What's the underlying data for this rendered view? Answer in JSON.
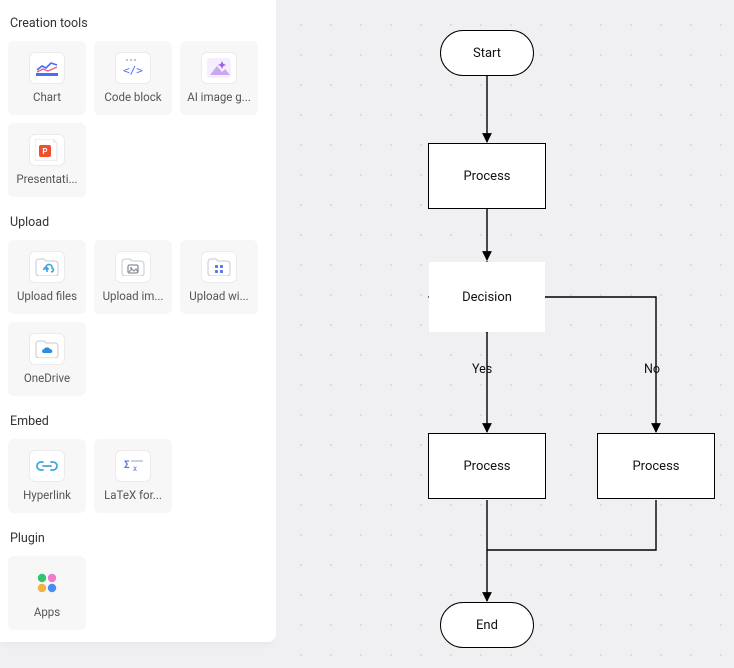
{
  "sidebar": {
    "sections": {
      "creation": {
        "heading": "Creation tools"
      },
      "upload": {
        "heading": "Upload"
      },
      "embed": {
        "heading": "Embed"
      },
      "plugin": {
        "heading": "Plugin"
      }
    },
    "tools": {
      "chart": {
        "label": "Chart"
      },
      "codeblock": {
        "label": "Code block"
      },
      "aiimage": {
        "label": "AI image g..."
      },
      "presentati": {
        "label": "Presentati..."
      },
      "uploadfiles": {
        "label": "Upload files"
      },
      "uploadim": {
        "label": "Upload im..."
      },
      "uploadwi": {
        "label": "Upload wi..."
      },
      "onedrive": {
        "label": "OneDrive"
      },
      "hyperlink": {
        "label": "Hyperlink"
      },
      "latex": {
        "label": "LaTeX for..."
      },
      "apps": {
        "label": "Apps"
      }
    }
  },
  "flow": {
    "start": {
      "label": "Start"
    },
    "process1": {
      "label": "Process"
    },
    "decision": {
      "label": "Decision"
    },
    "processY": {
      "label": "Process"
    },
    "processN": {
      "label": "Process"
    },
    "end": {
      "label": "End"
    },
    "edgeYes": "Yes",
    "edgeNo": "No"
  }
}
